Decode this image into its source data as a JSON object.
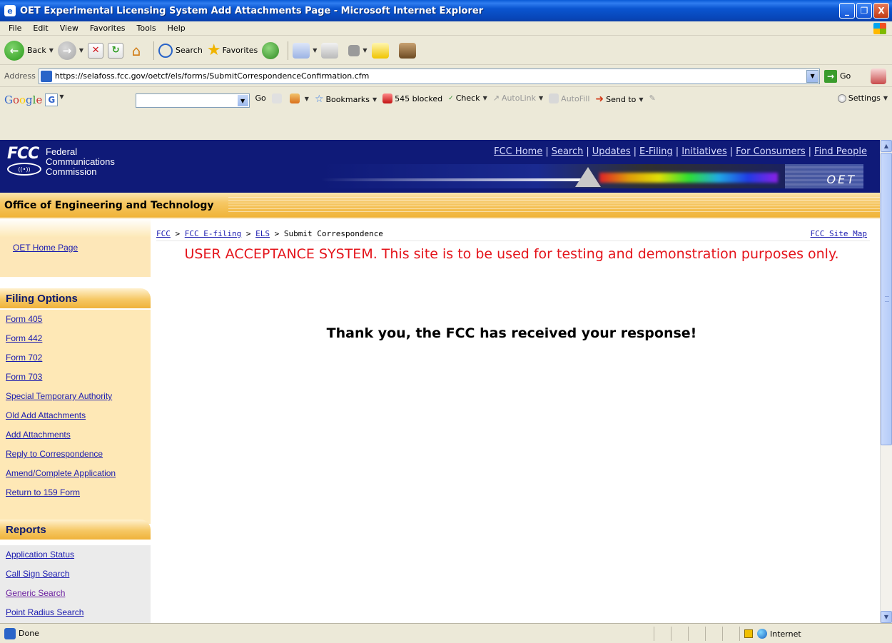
{
  "window": {
    "title": "OET Experimental Licensing System Add Attachments Page - Microsoft Internet Explorer",
    "min_glyph": "_",
    "max_glyph": "❐",
    "close_glyph": "X"
  },
  "menu": [
    "File",
    "Edit",
    "View",
    "Favorites",
    "Tools",
    "Help"
  ],
  "toolbar": {
    "back_label": "Back",
    "search_label": "Search",
    "favorites_label": "Favorites"
  },
  "address": {
    "label": "Address",
    "url": "https://selafoss.fcc.gov/oetcf/els/forms/SubmitCorrespondenceConfirmation.cfm",
    "go_label": "Go"
  },
  "google": {
    "logo_g": "G",
    "go_label": "Go",
    "bookmarks_label": "Bookmarks",
    "blocked_label": "545 blocked",
    "check_label": "Check",
    "autolink_label": "AutoLink",
    "autofill_label": "AutoFill",
    "sendto_label": "Send to",
    "settings_label": "Settings"
  },
  "header": {
    "logo_mark": "FCC",
    "logo_words": [
      "Federal",
      "Communications",
      "Commission"
    ],
    "links": [
      "FCC Home",
      "Search",
      "Updates",
      "E-Filing",
      "Initiatives",
      "For Consumers",
      "Find People"
    ],
    "oet_mark": "OET",
    "band_title": "Office of Engineering and Technology"
  },
  "sidebar": {
    "home_link": "OET Home Page",
    "filing_title": "Filing Options",
    "filing_items": [
      "Form 405",
      "Form 442",
      "Form 702",
      "Form 703",
      "Special Temporary Authority",
      "Old Add Attachments",
      "Add Attachments",
      "Reply to Correspondence",
      "Amend/Complete Application",
      "Return to 159 Form"
    ],
    "reports_title": "Reports",
    "report_items": [
      "Application Status",
      "Call Sign Search",
      "Generic Search",
      "Point Radius Search"
    ]
  },
  "content": {
    "breadcrumb": {
      "items": [
        "FCC",
        "FCC E-filing",
        "ELS"
      ],
      "current": "Submit Correspondence",
      "separator": ">"
    },
    "site_map": "FCC Site Map",
    "uas_notice": "USER ACCEPTANCE SYSTEM. This site is to be used for testing and demonstration purposes only.",
    "thanks": "Thank you, the FCC has received your response!"
  },
  "status": {
    "text": "Done",
    "zone": "Internet"
  }
}
